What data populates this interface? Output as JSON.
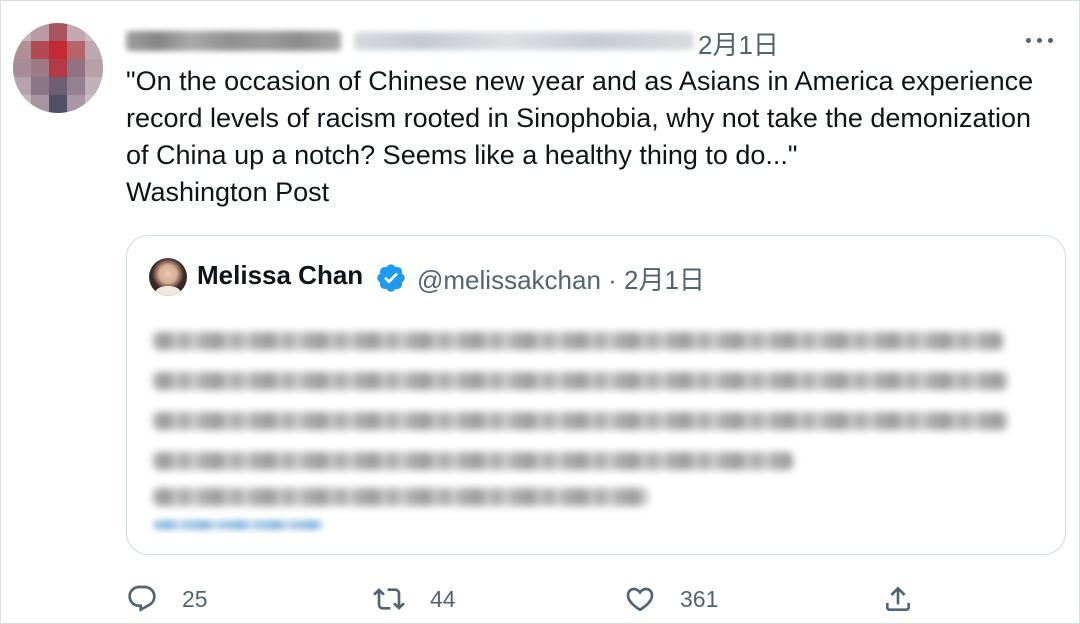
{
  "tweet": {
    "time": "2月1日",
    "text_lines": [
      "\"On the occasion of Chinese new year and as Asians in America experience",
      "record levels of racism rooted in Sinophobia, why not take the demonization",
      "of China up a notch? Seems like a healthy thing to do...\"",
      "Washington Post"
    ]
  },
  "quote": {
    "name": "Melissa Chan",
    "handle_time": "@melissakchan · 2月1日"
  },
  "actions": {
    "replies": "25",
    "retweets": "44",
    "likes": "361"
  },
  "colors": {
    "secondary_text": "#536471",
    "primary_text": "#0f1419",
    "verified_blue": "#1d9bf0",
    "border": "#cfd9de"
  },
  "icons": {
    "more": "more-dots-icon",
    "verified": "verified-badge-icon",
    "reply": "reply-icon",
    "retweet": "retweet-icon",
    "like": "heart-icon",
    "share": "share-icon"
  }
}
